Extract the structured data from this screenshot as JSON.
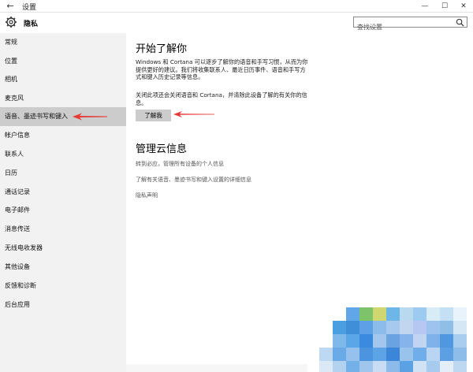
{
  "window": {
    "title": "设置",
    "controls": [
      "—",
      "☐",
      "✕"
    ]
  },
  "header": {
    "title": "隐私",
    "search_placeholder": "查找设置"
  },
  "sidebar": {
    "items": [
      {
        "label": "常规"
      },
      {
        "label": "位置"
      },
      {
        "label": "相机"
      },
      {
        "label": "麦克风"
      },
      {
        "label": "语音、墨迹书写和键入",
        "selected": true
      },
      {
        "label": "帐户信息"
      },
      {
        "label": "联系人"
      },
      {
        "label": "日历"
      },
      {
        "label": "通话记录"
      },
      {
        "label": "电子邮件"
      },
      {
        "label": "消息传送"
      },
      {
        "label": "无线电收发器"
      },
      {
        "label": "其他设备"
      },
      {
        "label": "反馈和诊断"
      },
      {
        "label": "后台应用"
      }
    ]
  },
  "main": {
    "section1_title": "开始了解你",
    "section1_para1": "Windows 和 Cortana 可以逐步了解你的语音和手写习惯，从而为你提供更好的建议。我们将收集联系人、最近日历事件、语音和手写方式和键入历史记录等信息。",
    "section1_para2": "关闭此项还会关闭语音和 Cortana，并清除此设备了解的有关你的信息。",
    "button_label": "了解我",
    "section2_title": "管理云信息",
    "links": [
      "转到必应，管理所有设备的个人信息",
      "了解有关语音、墨迹书写和键入设置的详细信息",
      "隐私声明"
    ]
  },
  "colors": {
    "sidebar_bg": "#f2f2f2",
    "selected_bg": "#cccccc",
    "arrow": "#e53935",
    "button_bg": "#cccccc"
  }
}
